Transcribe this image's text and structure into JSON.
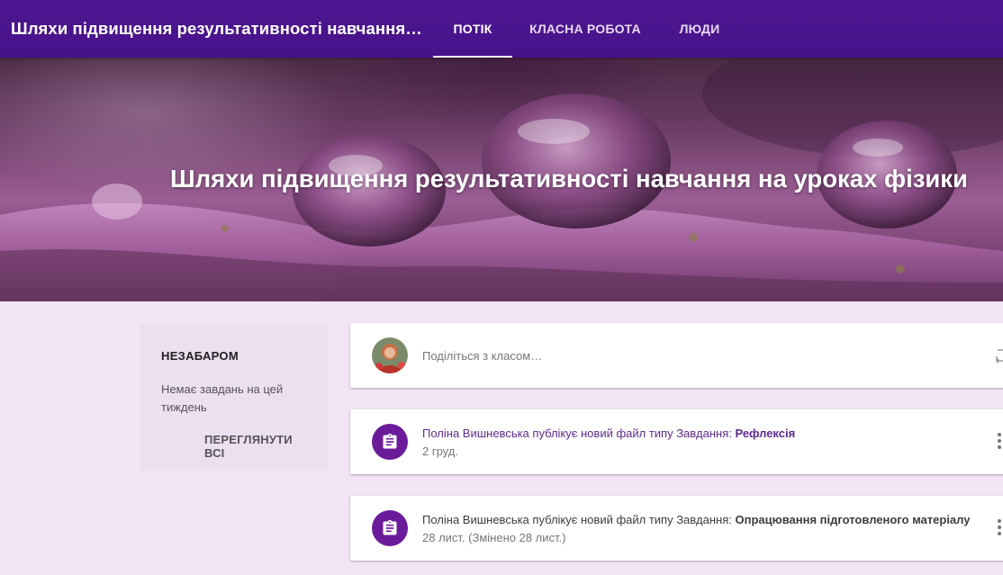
{
  "header": {
    "course_title": "Шляхи підвищення результативності навчання…",
    "tabs": [
      {
        "label": "ПОТІК",
        "active": true
      },
      {
        "label": "КЛАСНА РОБОТА",
        "active": false
      },
      {
        "label": "ЛЮДИ",
        "active": false
      }
    ],
    "color": "#4a148c"
  },
  "banner": {
    "title": "Шляхи підвищення результативності навчання на уроках фізики"
  },
  "upcoming": {
    "title": "НЕЗАБАРОМ",
    "empty_text": "Немає завдань на цей тиждень",
    "view_all_label": "ПЕРЕГЛЯНУТИ ВСІ"
  },
  "share": {
    "placeholder": "Поділіться з класом…",
    "avatar_icon": "user-avatar",
    "side_icon": "repost-icon"
  },
  "posts": [
    {
      "text": "Поліна Вишневська публікує новий файл типу Завдання: ",
      "title": "Рефлексія",
      "date": "2 груд.",
      "icon": "assignment-icon",
      "text_color": "#5e2a8f"
    },
    {
      "text": "Поліна Вишневська публікує новий файл типу Завдання: ",
      "title": "Опрацювання підготовленого матеріалу",
      "date": "28 лист. (Змінено 28 лист.)",
      "icon": "assignment-icon",
      "text_color": "#3c3c3c"
    }
  ],
  "accent_color": "#6a1b9a",
  "background_color": "#f3e5f5"
}
